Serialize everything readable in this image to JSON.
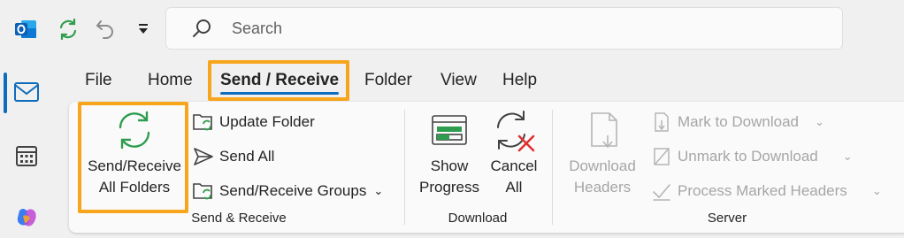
{
  "titlebar": {
    "app_icon": "outlook-icon",
    "sync_icon": "sync-icon",
    "undo_icon": "undo-icon",
    "customize_icon": "quick-access-dropdown-icon"
  },
  "search": {
    "placeholder": "Search",
    "icon": "search-icon"
  },
  "rail": {
    "items": [
      {
        "name": "mail-icon",
        "active": true
      },
      {
        "name": "calendar-icon",
        "active": false
      },
      {
        "name": "copilot-icon",
        "active": false
      }
    ]
  },
  "tabs": [
    {
      "label": "File"
    },
    {
      "label": "Home"
    },
    {
      "label": "Send / Receive",
      "active": true
    },
    {
      "label": "Folder"
    },
    {
      "label": "View"
    },
    {
      "label": "Help"
    }
  ],
  "ribbon": {
    "send_receive": {
      "group_label": "Send & Receive",
      "send_receive_all": [
        "Send/Receive",
        "All Folders"
      ],
      "update_folder": "Update Folder",
      "send_all": "Send All",
      "groups": "Send/Receive Groups"
    },
    "download": {
      "group_label": "Download",
      "show_progress": [
        "Show",
        "Progress"
      ],
      "cancel_all": [
        "Cancel",
        "All"
      ]
    },
    "server": {
      "group_label": "Server",
      "download_headers": [
        "Download",
        "Headers"
      ],
      "mark_to_download": "Mark to Download",
      "unmark_to_download": "Unmark to Download",
      "process_marked_headers": "Process Marked Headers"
    }
  },
  "colors": {
    "accent": "#0f6cbd",
    "highlight": "#f7a51c",
    "sync_green": "#2e9d4f",
    "cancel_red": "#e03030"
  }
}
